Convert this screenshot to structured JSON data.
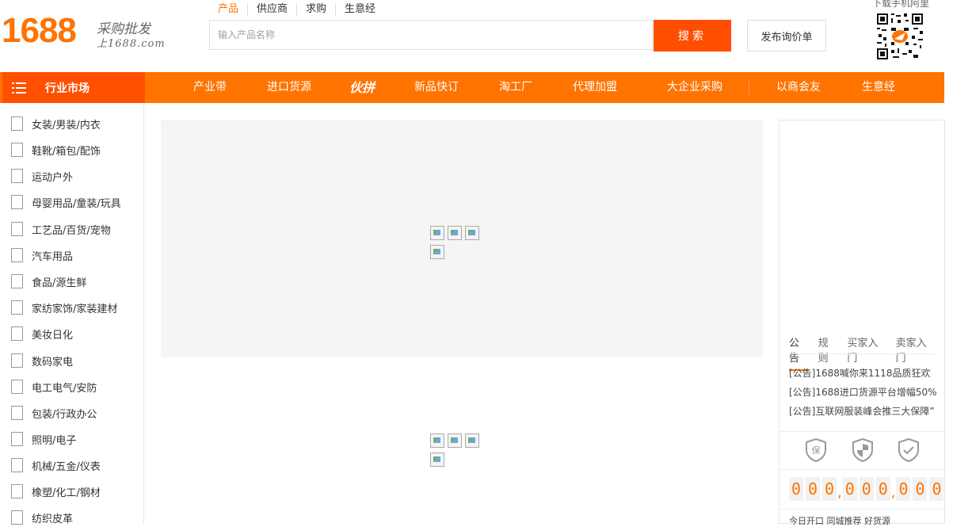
{
  "logo": {
    "number": "1688",
    "tagline1": "采购批发",
    "tagline2": "上1688.com"
  },
  "search": {
    "tabs": [
      "产品",
      "供应商",
      "求购",
      "生意经"
    ],
    "placeholder": "输入产品名称",
    "button": "搜索"
  },
  "rfq_button": "发布询价单",
  "app_download": "下载手机阿里",
  "nav": {
    "category_title": "行业市场",
    "items": [
      "产业带",
      "进口货源",
      "伙拼",
      "新品快订",
      "淘工厂",
      "代理加盟",
      "大企业采购",
      "以商会友",
      "生意经"
    ]
  },
  "categories": [
    "女装/男装/内衣",
    "鞋靴/箱包/配饰",
    "运动户外",
    "母婴用品/童装/玩具",
    "工艺品/百货/宠物",
    "汽车用品",
    "食品/源生鲜",
    "家纺家饰/家装建材",
    "美妆日化",
    "数码家电",
    "电工电气/安防",
    "包装/行政办公",
    "照明/电子",
    "机械/五金/仪表",
    "橡塑/化工/钢材",
    "纺织皮革"
  ],
  "panel": {
    "tabs": [
      "公告",
      "规则",
      "买家入门",
      "卖家入门"
    ],
    "notices": [
      "[公告]1688喊你来1118品质狂欢",
      "[公告]1688进口货源平台增幅50%",
      "[公告]互联网服装峰会推三大保障”"
    ],
    "shield_icons": [
      "guarantee-shield-icon",
      "security-shield-icon",
      "verified-shield-icon"
    ],
    "counter_digits": [
      "0",
      "0",
      "0",
      "0",
      "0",
      "0",
      "0",
      "0",
      "0"
    ],
    "counter_separator": ",",
    "bottom_text": "今日开口 同城推荐 好货源"
  },
  "colors": {
    "brand": "#ff7300",
    "search_button": "#ff4e00",
    "nav_highlight": "#ff5000"
  }
}
